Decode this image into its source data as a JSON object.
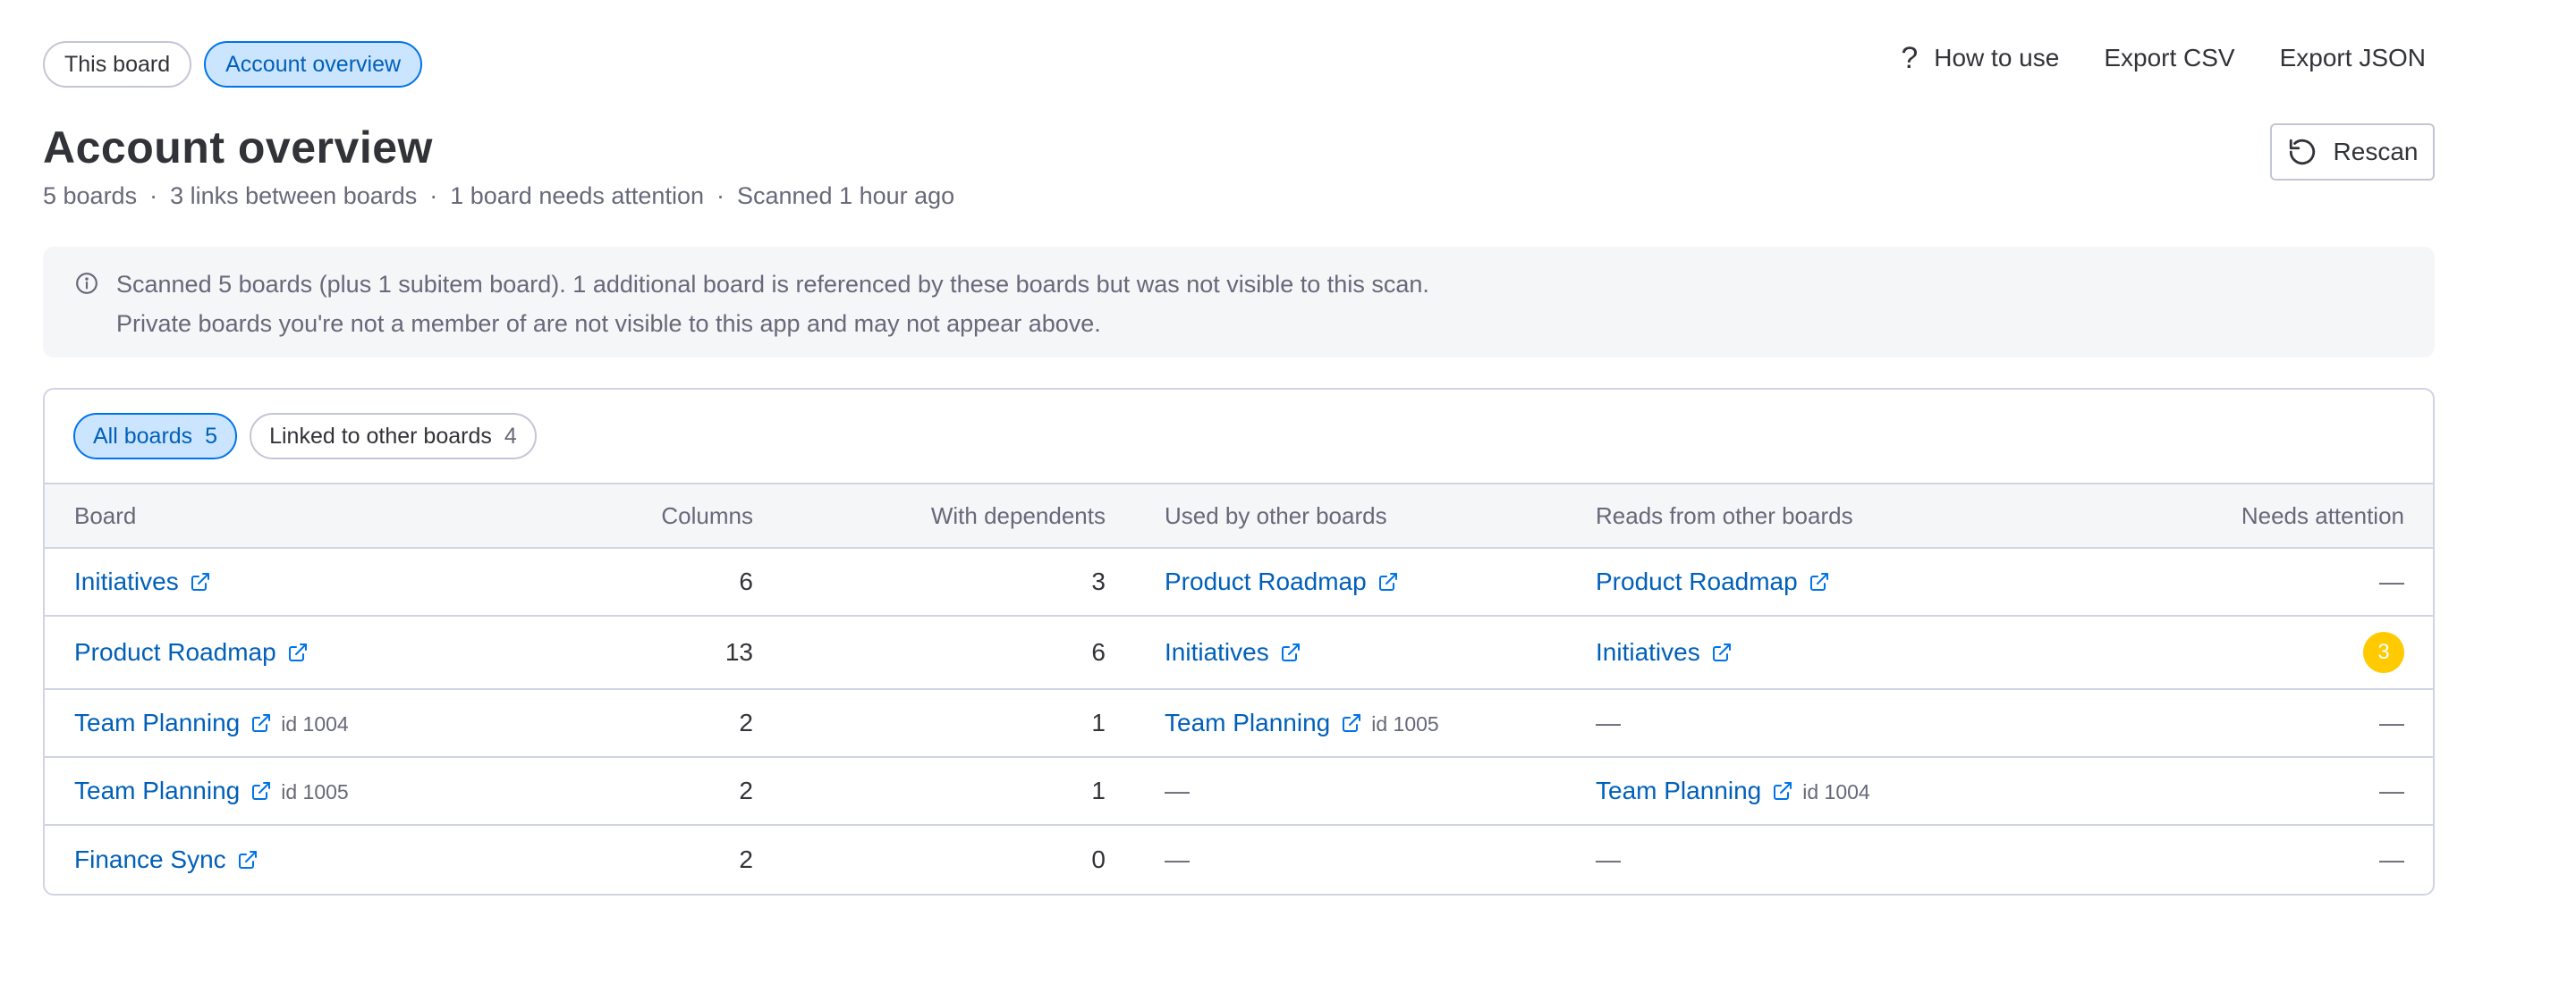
{
  "top_tabs": [
    {
      "label": "This board",
      "active": false
    },
    {
      "label": "Account overview",
      "active": true
    }
  ],
  "actions": {
    "help": "How to use",
    "export_csv": "Export CSV",
    "export_json": "Export JSON"
  },
  "header": {
    "title": "Account overview",
    "meta": [
      "5 boards",
      "3 links between boards",
      "1 board needs attention",
      "Scanned 1 hour ago"
    ],
    "rescan_label": "Rescan"
  },
  "notice": {
    "line1": "Scanned 5 boards (plus 1 subitem board). 1 additional board is referenced by these boards but was not visible to this scan.",
    "line2": "Private boards you're not a member of are not visible to this app and may not appear above."
  },
  "filters": [
    {
      "label": "All boards",
      "count": "5",
      "active": true
    },
    {
      "label": "Linked to other boards",
      "count": "4",
      "active": false
    }
  ],
  "table": {
    "headers": [
      "Board",
      "Columns",
      "With dependents",
      "Used by other boards",
      "Reads from other boards",
      "Needs attention"
    ],
    "rows": [
      {
        "board": "Initiatives",
        "board_id": "",
        "columns": "6",
        "dependents": "3",
        "used_by": "Product Roadmap",
        "used_by_id": "",
        "reads": "Product Roadmap",
        "reads_id": "",
        "attention": "—"
      },
      {
        "board": "Product Roadmap",
        "board_id": "",
        "columns": "13",
        "dependents": "6",
        "used_by": "Initiatives",
        "used_by_id": "",
        "reads": "Initiatives",
        "reads_id": "",
        "attention": "3"
      },
      {
        "board": "Team Planning",
        "board_id": "id 1004",
        "columns": "2",
        "dependents": "1",
        "used_by": "Team Planning",
        "used_by_id": "id 1005",
        "reads": "—",
        "reads_id": "",
        "attention": "—"
      },
      {
        "board": "Team Planning",
        "board_id": "id 1005",
        "columns": "2",
        "dependents": "1",
        "used_by": "—",
        "used_by_id": "",
        "reads": "Team Planning",
        "reads_id": "id 1004",
        "attention": "—"
      },
      {
        "board": "Finance Sync",
        "board_id": "",
        "columns": "2",
        "dependents": "0",
        "used_by": "—",
        "used_by_id": "",
        "reads": "—",
        "reads_id": "",
        "attention": "—"
      }
    ]
  },
  "colors": {
    "accent": "#0073ea",
    "link": "#0060b9",
    "attention_badge": "#ffcb00"
  },
  "icons": {
    "help": "question-mark-icon",
    "rescan": "refresh-icon",
    "info": "info-icon",
    "external": "external-link-icon"
  }
}
